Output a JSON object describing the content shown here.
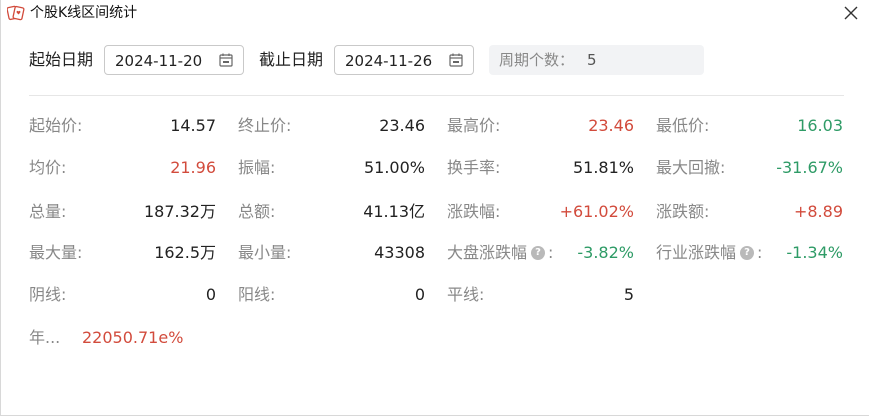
{
  "window": {
    "title": "个股K线区间统计"
  },
  "controls": {
    "start_label": "起始日期",
    "start_date": "2024-11-20",
    "end_label": "截止日期",
    "end_date": "2024-11-26",
    "period_label": "周期个数：",
    "period_value": "5"
  },
  "stats": {
    "r1": {
      "c1": {
        "label": "起始价:",
        "value": "14.57"
      },
      "c2": {
        "label": "终止价:",
        "value": "23.46"
      },
      "c3": {
        "label": "最高价:",
        "value": "23.46"
      },
      "c4": {
        "label": "最低价:",
        "value": "16.03"
      }
    },
    "r2": {
      "c1": {
        "label": "均价:",
        "value": "21.96"
      },
      "c2": {
        "label": "振幅:",
        "value": "51.00%"
      },
      "c3": {
        "label": "换手率:",
        "value": "51.81%"
      },
      "c4": {
        "label": "最大回撤:",
        "value": "-31.67%"
      }
    },
    "r3": {
      "c1": {
        "label": "总量:",
        "value": "187.32万"
      },
      "c2": {
        "label": "总额:",
        "value": "41.13亿"
      },
      "c3": {
        "label": "涨跌幅:",
        "value": "+61.02%"
      },
      "c4": {
        "label": "涨跌额:",
        "value": "+8.89"
      }
    },
    "r4": {
      "c1": {
        "label": "最大量:",
        "value": "162.5万"
      },
      "c2": {
        "label": "最小量:",
        "value": "43308"
      },
      "c3": {
        "label": "大盘涨跌幅",
        "colon": ":",
        "value": "-3.82%"
      },
      "c4": {
        "label": "行业涨跌幅",
        "colon": ":",
        "value": "-1.34%"
      }
    },
    "r5": {
      "c1": {
        "label": "阴线:",
        "value": "0"
      },
      "c2": {
        "label": "阳线:",
        "value": "0"
      },
      "c3": {
        "label": "平线:",
        "value": "5"
      }
    },
    "r6": {
      "c1": {
        "label": "年...",
        "value": "22050.71e%"
      }
    }
  },
  "colors": {
    "red": "#d24b3c",
    "green": "#2e9b66"
  },
  "icons": {
    "app": "poker-cards-icon",
    "close": "close-icon",
    "calendar": "calendar-icon",
    "help": "question-circle-icon"
  }
}
